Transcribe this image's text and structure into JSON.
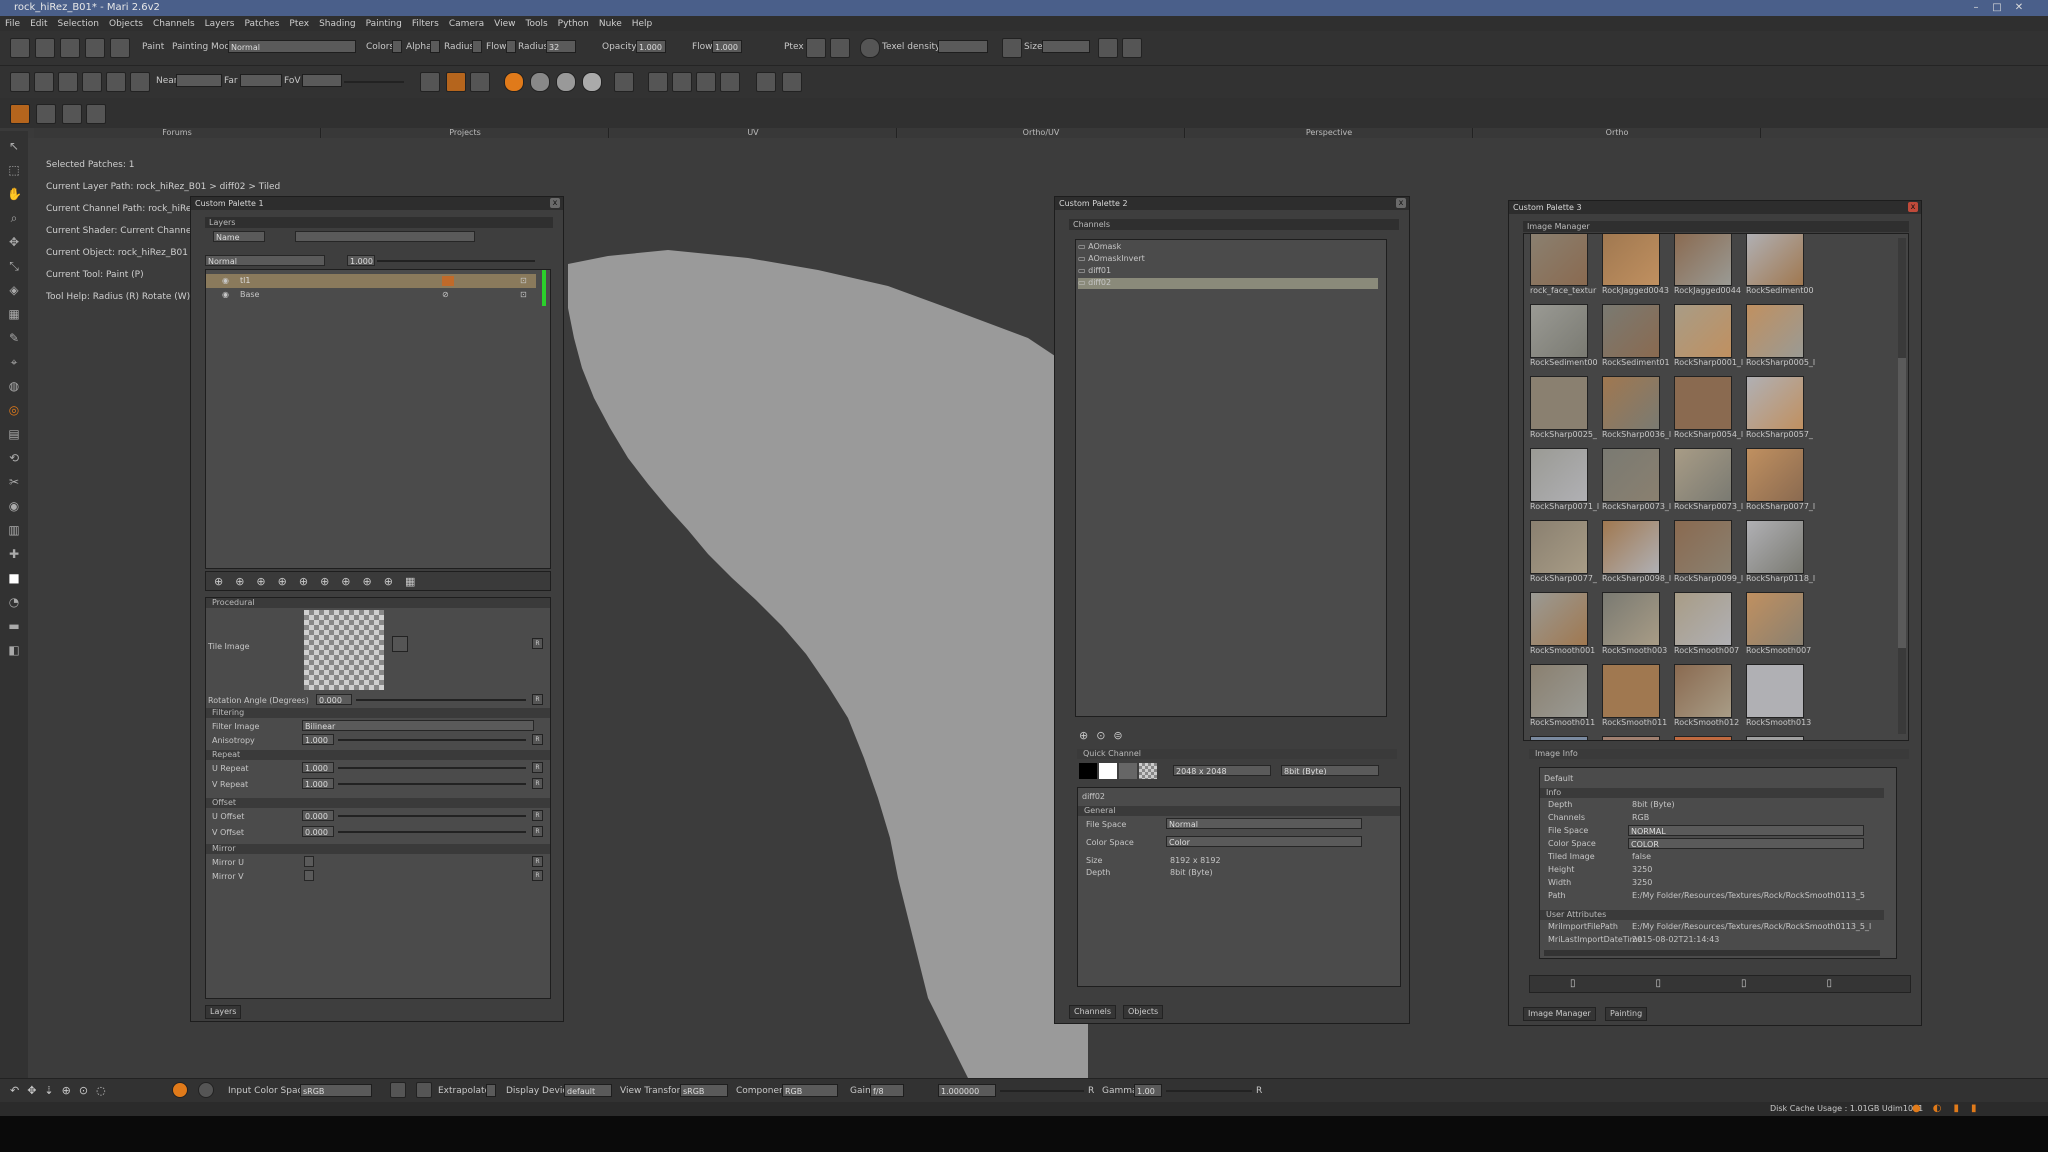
{
  "window": {
    "title": "rock_hiRez_B01* - Mari 2.6v2"
  },
  "menu": [
    "File",
    "Edit",
    "Selection",
    "Objects",
    "Channels",
    "Layers",
    "Patches",
    "Ptex",
    "Shading",
    "Painting",
    "Filters",
    "Camera",
    "View",
    "Tools",
    "Python",
    "Nuke",
    "Help"
  ],
  "toolbar1": {
    "paint_label": "Paint",
    "painting_mode_label": "Painting Mode",
    "painting_mode_value": "Normal",
    "colors": "Colors",
    "alpha": "Alpha",
    "radius": "Radius",
    "flow": "Flow",
    "radius2": "Radius",
    "radius_value": "32",
    "opacity": "Opacity",
    "opacity_value": "1.000",
    "flow2": "Flow",
    "flow_value": "1.000",
    "ptex": "Ptex",
    "texel_density": "Texel density",
    "size": "Size"
  },
  "toolbar2": {
    "near": "Near",
    "far": "Far",
    "fov": "FoV"
  },
  "view_tabs": [
    "Forums",
    "Projects",
    "UV",
    "Ortho/UV",
    "Perspective",
    "Ortho"
  ],
  "info_lines": [
    "Selected Patches: 1",
    "Current Layer Path: rock_hiRez_B01 > diff02 > Tiled",
    "Current Channel Path: rock_hiRez_B",
    "Current Shader: Current Channel",
    "Current Object: rock_hiRez_B01",
    "Current Tool: Paint (P)",
    "Tool Help:    Radius (R)   Rotate (W)"
  ],
  "palette1": {
    "title": "Custom Palette 1",
    "sub": "Layers",
    "filter_mode": "Name",
    "blend": "Normal",
    "blend_value": "1.000",
    "layers": [
      {
        "name": "tl1"
      },
      {
        "name": "Base"
      }
    ],
    "procedural": "Procedural",
    "tile_image": "Tile Image",
    "rotation_label": "Rotation Angle (Degrees)",
    "rotation_value": "0.000",
    "filtering": "Filtering",
    "filter_image": "Filter Image",
    "filter_image_value": "Bilinear",
    "anisotropy": "Anisotropy",
    "anisotropy_value": "1.000",
    "repeat": "Repeat",
    "u_repeat": "U Repeat",
    "u_repeat_value": "1.000",
    "v_repeat": "V Repeat",
    "v_repeat_value": "1.000",
    "offset": "Offset",
    "u_offset": "U Offset",
    "u_offset_value": "0.000",
    "v_offset": "V Offset",
    "v_offset_value": "0.000",
    "mirror": "Mirror",
    "mirror_u": "Mirror U",
    "mirror_v": "Mirror V",
    "r": "R",
    "tab": "Layers"
  },
  "palette2": {
    "title": "Custom Palette 2",
    "sub": "Channels",
    "channels": [
      "AOmask",
      "AOmaskInvert",
      "diff01",
      "diff02"
    ],
    "quick_channel": "Quick Channel",
    "qc_size": "2048 x 2048",
    "qc_depth": "8bit (Byte)",
    "channel_name": "diff02",
    "general": "General",
    "file_space": "File Space",
    "file_space_value": "Normal",
    "color_space": "Color Space",
    "color_space_value": "Color",
    "size": "Size",
    "size_value": "8192 x 8192",
    "depth": "Depth",
    "depth_value": "8bit (Byte)",
    "tabs": [
      "Channels",
      "Objects"
    ]
  },
  "palette3": {
    "title": "Custom Palette 3",
    "sub": "Image Manager",
    "thumb_rows": [
      [
        "rock_face_textur",
        "RockJagged0043",
        "RockJagged0044",
        "RockSediment00"
      ],
      [
        "RockSediment00",
        "RockSediment01",
        "RockSharp0001_l",
        "RockSharp0005_l"
      ],
      [
        "RockSharp0025_",
        "RockSharp0036_l",
        "RockSharp0054_l",
        "RockSharp0057_"
      ],
      [
        "RockSharp0071_l",
        "RockSharp0073_l",
        "RockSharp0073_l",
        "RockSharp0077_l"
      ],
      [
        "RockSharp0077_",
        "RockSharp0098_l",
        "RockSharp0099_l",
        "RockSharp0118_l"
      ],
      [
        "RockSmooth001",
        "RockSmooth003",
        "RockSmooth007",
        "RockSmooth007"
      ],
      [
        "RockSmooth011",
        "RockSmooth011",
        "RockSmooth012",
        "RockSmooth013"
      ]
    ],
    "image_info": "Image Info",
    "default": "Default",
    "info": "Info",
    "props": [
      [
        "Depth",
        "8bit (Byte)"
      ],
      [
        "Channels",
        "RGB"
      ],
      [
        "File Space",
        "NORMAL"
      ],
      [
        "Color Space",
        "COLOR"
      ],
      [
        "Tiled Image",
        "false"
      ],
      [
        "Height",
        "3250"
      ],
      [
        "Width",
        "3250"
      ],
      [
        "Path",
        "E:/My Folder/Resources/Textures/Rock/RockSmooth0113_5"
      ]
    ],
    "user_attrs": "User Attributes",
    "attrs": [
      [
        "MriImportFilePath",
        "E:/My Folder/Resources/Textures/Rock/RockSmooth0113_5_l"
      ],
      [
        "MriLastImportDateTime",
        "2015-08-02T21:14:43"
      ]
    ],
    "tabs": [
      "Image Manager",
      "Painting"
    ]
  },
  "statusbar": {
    "input_color_space": "Input Color Space",
    "ics_value": "sRGB",
    "extrapolate": "Extrapolate",
    "display_device": "Display Device",
    "dd_value": "default",
    "view_transform": "View Transform",
    "vt_value": "sRGB",
    "component": "Component",
    "comp_value": "RGB",
    "gain": "Gain",
    "gain_value": "f/8",
    "gain_num": "1.000000",
    "r": "R",
    "gamma": "Gamma",
    "gamma_value": "1.00",
    "r2": "R"
  },
  "bottom": {
    "disk_cache": "Disk Cache Usage : 1.01GB  Udim1001"
  },
  "colors": {
    "accent_orange": "#e07a1a",
    "titlebar": "#4a5f8a",
    "mesh_gray": "#9a9a9a"
  }
}
